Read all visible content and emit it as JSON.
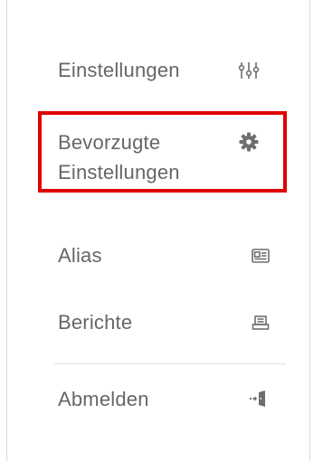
{
  "menu": {
    "items": [
      {
        "label": "Einstellungen",
        "icon": "sliders-icon"
      },
      {
        "label_lines": [
          "Bevorzugte",
          "Einstellungen"
        ],
        "icon": "gear-icon"
      },
      {
        "label": "Alias",
        "icon": "id-card-icon"
      },
      {
        "label": "Berichte",
        "icon": "printer-icon"
      },
      {
        "label": "Abmelden",
        "icon": "logout-door-icon"
      }
    ]
  },
  "colors": {
    "text": "#666666",
    "icon": "#6e6e6e",
    "highlight": "#e00000",
    "divider": "#e4e4e4"
  }
}
